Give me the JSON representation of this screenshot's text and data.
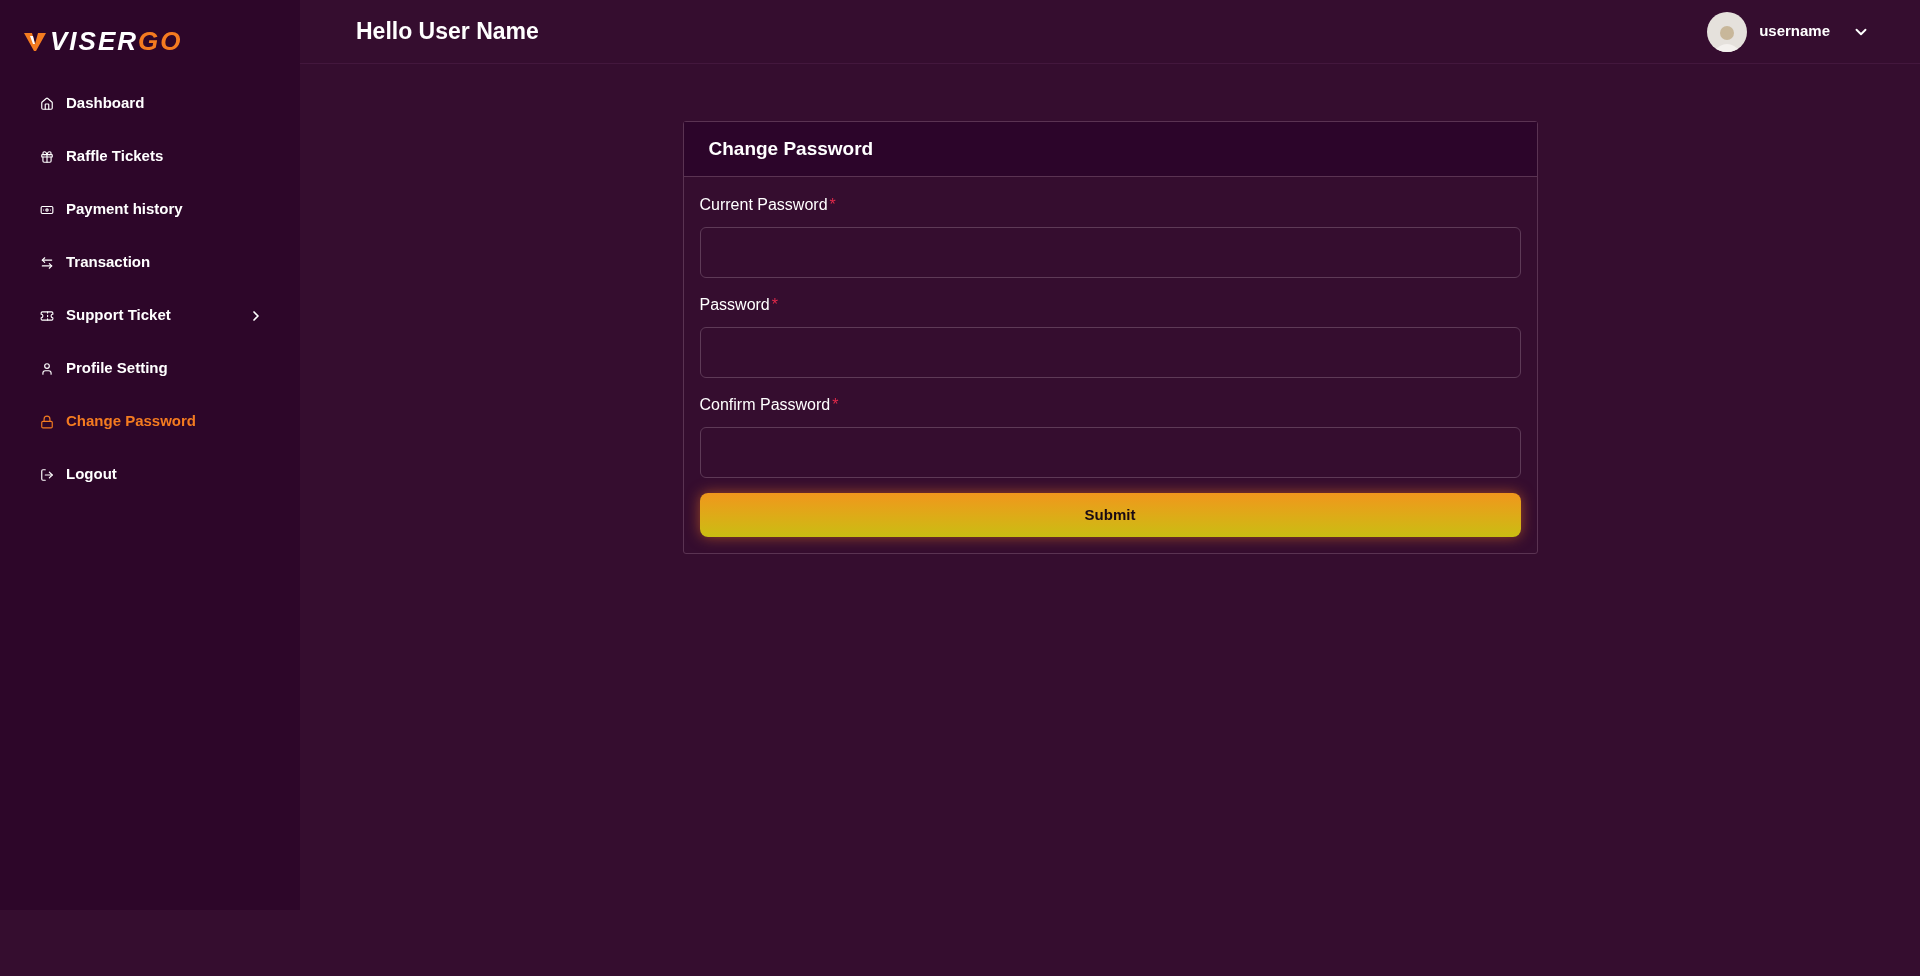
{
  "logo": {
    "text": "VISER",
    "accent": "GO"
  },
  "sidebar": {
    "items": [
      {
        "label": "Dashboard",
        "selected": false,
        "has_submenu": false
      },
      {
        "label": "Raffle Tickets",
        "selected": false,
        "has_submenu": false
      },
      {
        "label": "Payment history",
        "selected": false,
        "has_submenu": false
      },
      {
        "label": "Transaction",
        "selected": false,
        "has_submenu": false
      },
      {
        "label": "Support Ticket",
        "selected": false,
        "has_submenu": true
      },
      {
        "label": "Profile Setting",
        "selected": false,
        "has_submenu": false
      },
      {
        "label": "Change Password",
        "selected": true,
        "has_submenu": false
      },
      {
        "label": "Logout",
        "selected": false,
        "has_submenu": false
      }
    ]
  },
  "header": {
    "greeting": "Hello User Name",
    "user": {
      "name": "username"
    }
  },
  "form": {
    "title": "Change Password",
    "fields": [
      {
        "label": "Current Password",
        "required_mark": "*"
      },
      {
        "label": "Password",
        "required_mark": "*"
      },
      {
        "label": "Confirm Password",
        "required_mark": "*"
      }
    ],
    "submit": "Submit"
  }
}
